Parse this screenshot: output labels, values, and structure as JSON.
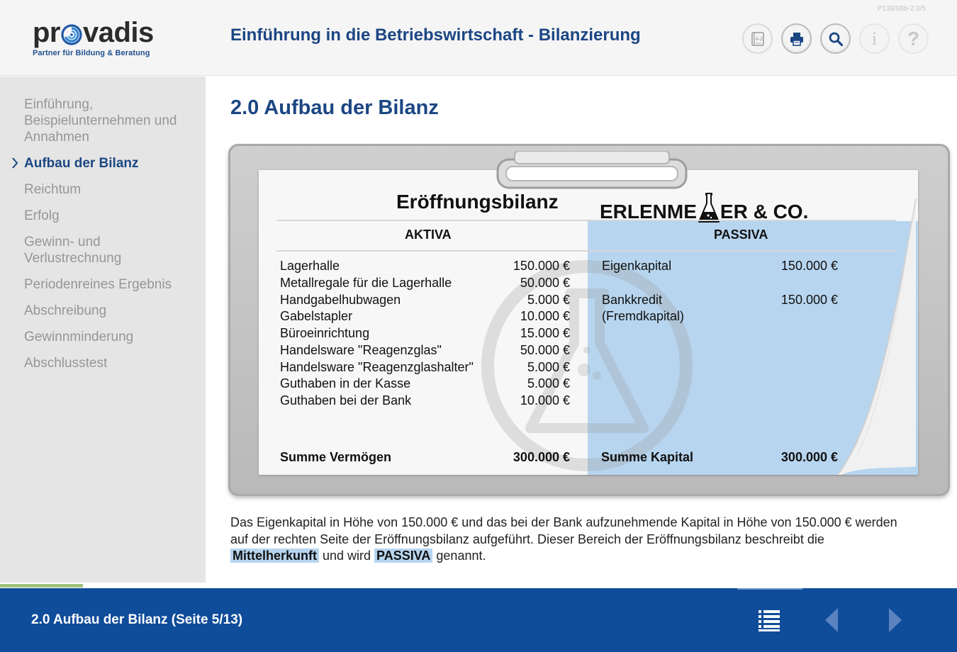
{
  "header": {
    "version": "P139/08b-2.0/5",
    "logo": {
      "word_left": "pr",
      "word_right": "vadis",
      "tagline": "Partner für Bildung & Beratung"
    },
    "title": "Einführung in die Betriebswirtschaft - Bilanzierung",
    "tools": [
      {
        "name": "glossary",
        "icon": "book-az-icon",
        "label": "A-Z"
      },
      {
        "name": "print",
        "icon": "printer-icon"
      },
      {
        "name": "search",
        "icon": "search-icon"
      },
      {
        "name": "info",
        "icon": "info-icon",
        "label": "i"
      },
      {
        "name": "help",
        "icon": "help-icon",
        "label": "?"
      }
    ]
  },
  "sidebar": {
    "items": [
      {
        "label": "Einführung, Beispielunternehmen und Annahmen",
        "current": false
      },
      {
        "label": "Aufbau der Bilanz",
        "current": true
      },
      {
        "label": "Reichtum",
        "current": false
      },
      {
        "label": "Erfolg",
        "current": false
      },
      {
        "label": "Gewinn- und Verlustrechnung",
        "current": false
      },
      {
        "label": "Periodenreines Ergebnis",
        "current": false
      },
      {
        "label": "Abschreibung",
        "current": false
      },
      {
        "label": "Gewinnminderung",
        "current": false
      },
      {
        "label": "Abschlusstest",
        "current": false
      }
    ]
  },
  "main": {
    "title": "2.0 Aufbau der Bilanz",
    "bilanz": {
      "heading": "Eröffnungsbilanz",
      "company_left": "ERLENME",
      "company_right": "ER & CO.",
      "aktiva": {
        "label": "AKTIVA",
        "items": [
          {
            "name": "Lagerhalle",
            "amount": "150.000 €"
          },
          {
            "name": "Metallregale für die Lagerhalle",
            "amount": "50.000 €"
          },
          {
            "name": "Handgabelhubwagen",
            "amount": "5.000 €"
          },
          {
            "name": "Gabelstapler",
            "amount": "10.000 €"
          },
          {
            "name": "Büroeinrichtung",
            "amount": "15.000 €"
          },
          {
            "name": "Handelsware \"Reagenzglas\"",
            "amount": "50.000 €"
          },
          {
            "name": "Handelsware \"Reagenzglashalter\"",
            "amount": "5.000 €"
          },
          {
            "name": "Guthaben in der Kasse",
            "amount": "5.000 €"
          },
          {
            "name": "Guthaben bei der Bank",
            "amount": "10.000 €"
          }
        ],
        "sum_label": "Summe Vermögen",
        "sum_amount": "300.000 €"
      },
      "passiva": {
        "label": "PASSIVA",
        "items": [
          {
            "name": "Eigenkapital",
            "amount": "150.000 €"
          },
          {
            "name": "Bankkredit",
            "name_line2": "(Fremdkapital)",
            "amount": "150.000 €"
          }
        ],
        "sum_label": "Summe Kapital",
        "sum_amount": "300.000 €"
      }
    },
    "description": {
      "part1": "Das Eigenkapital in Höhe von 150.000 € und das bei der Bank aufzunehmende Kapital in Höhe von 150.000 € werden auf der rechten Seite der Eröffnungsbilanz aufgeführt. Dieser Bereich der Eröffnungsbilanz beschreibt die ",
      "highlight1": "Mittelherkunft",
      "part2": " und wird ",
      "highlight2": "PASSIVA",
      "part3": " genannt."
    }
  },
  "footer": {
    "page_title": "2.0 Aufbau der Bilanz (Seite 5/13)",
    "buttons": {
      "toc": "toc-list-icon",
      "prev": "prev-arrow-icon",
      "next": "next-arrow-icon"
    }
  },
  "colors": {
    "brand_blue": "#1b4683",
    "footer_blue": "#0f4c9a",
    "passiva_highlight": "#b7d5ef",
    "sidebar_bg": "#e5e5e5",
    "progress_green": "#9fc27b"
  }
}
